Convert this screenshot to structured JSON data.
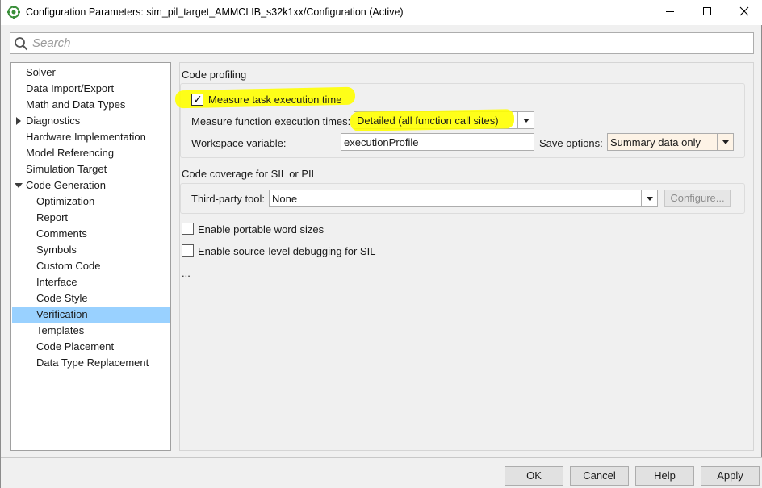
{
  "window": {
    "title": "Configuration Parameters: sim_pil_target_AMMCLIB_s32k1xx/Configuration (Active)",
    "app_icon": "simulink-config-icon",
    "controls": {
      "minimize_icon": "minimize-icon",
      "maximize_icon": "maximize-icon",
      "close_icon": "close-icon"
    }
  },
  "search": {
    "placeholder": "Search",
    "value": "",
    "icon": "search-icon"
  },
  "tree": {
    "items": [
      {
        "label": "Solver",
        "level": 0,
        "expander": "none",
        "selected": false
      },
      {
        "label": "Data Import/Export",
        "level": 0,
        "expander": "none",
        "selected": false
      },
      {
        "label": "Math and Data Types",
        "level": 0,
        "expander": "none",
        "selected": false
      },
      {
        "label": "Diagnostics",
        "level": 0,
        "expander": "collapsed",
        "selected": false
      },
      {
        "label": "Hardware Implementation",
        "level": 0,
        "expander": "none",
        "selected": false
      },
      {
        "label": "Model Referencing",
        "level": 0,
        "expander": "none",
        "selected": false
      },
      {
        "label": "Simulation Target",
        "level": 0,
        "expander": "none",
        "selected": false
      },
      {
        "label": "Code Generation",
        "level": 0,
        "expander": "expanded",
        "selected": false
      },
      {
        "label": "Optimization",
        "level": 1,
        "expander": "none",
        "selected": false
      },
      {
        "label": "Report",
        "level": 1,
        "expander": "none",
        "selected": false
      },
      {
        "label": "Comments",
        "level": 1,
        "expander": "none",
        "selected": false
      },
      {
        "label": "Symbols",
        "level": 1,
        "expander": "none",
        "selected": false
      },
      {
        "label": "Custom Code",
        "level": 1,
        "expander": "none",
        "selected": false
      },
      {
        "label": "Interface",
        "level": 1,
        "expander": "none",
        "selected": false
      },
      {
        "label": "Code Style",
        "level": 1,
        "expander": "none",
        "selected": false
      },
      {
        "label": "Verification",
        "level": 1,
        "expander": "none",
        "selected": true
      },
      {
        "label": "Templates",
        "level": 1,
        "expander": "none",
        "selected": false
      },
      {
        "label": "Code Placement",
        "level": 1,
        "expander": "none",
        "selected": false
      },
      {
        "label": "Data Type Replacement",
        "level": 1,
        "expander": "none",
        "selected": false
      }
    ]
  },
  "profiling": {
    "section_title": "Code profiling",
    "measure_task": {
      "label": "Measure task execution time",
      "checked": true
    },
    "measure_function": {
      "label": "Measure function execution times:",
      "value": "Detailed (all function call sites)"
    },
    "workspace_variable": {
      "label": "Workspace variable:",
      "value": "executionProfile"
    },
    "save_options": {
      "label": "Save options:",
      "value": "Summary data only"
    },
    "highlight_color": "#ffff00"
  },
  "coverage": {
    "section_title": "Code coverage for SIL or PIL",
    "third_party_tool": {
      "label": "Third-party tool:",
      "value": "None"
    },
    "configure_label": "Configure..."
  },
  "options": {
    "portable_word_sizes": {
      "label": "Enable portable word sizes",
      "checked": false
    },
    "source_level_debugging": {
      "label": "Enable source-level debugging for SIL",
      "checked": false
    },
    "more": "..."
  },
  "buttons": {
    "ok": "OK",
    "cancel": "Cancel",
    "help": "Help",
    "apply": "Apply"
  },
  "colors": {
    "selection": "#99d1ff",
    "highlight": "#ffff00",
    "save_options_bg": "#fdf3e6"
  }
}
